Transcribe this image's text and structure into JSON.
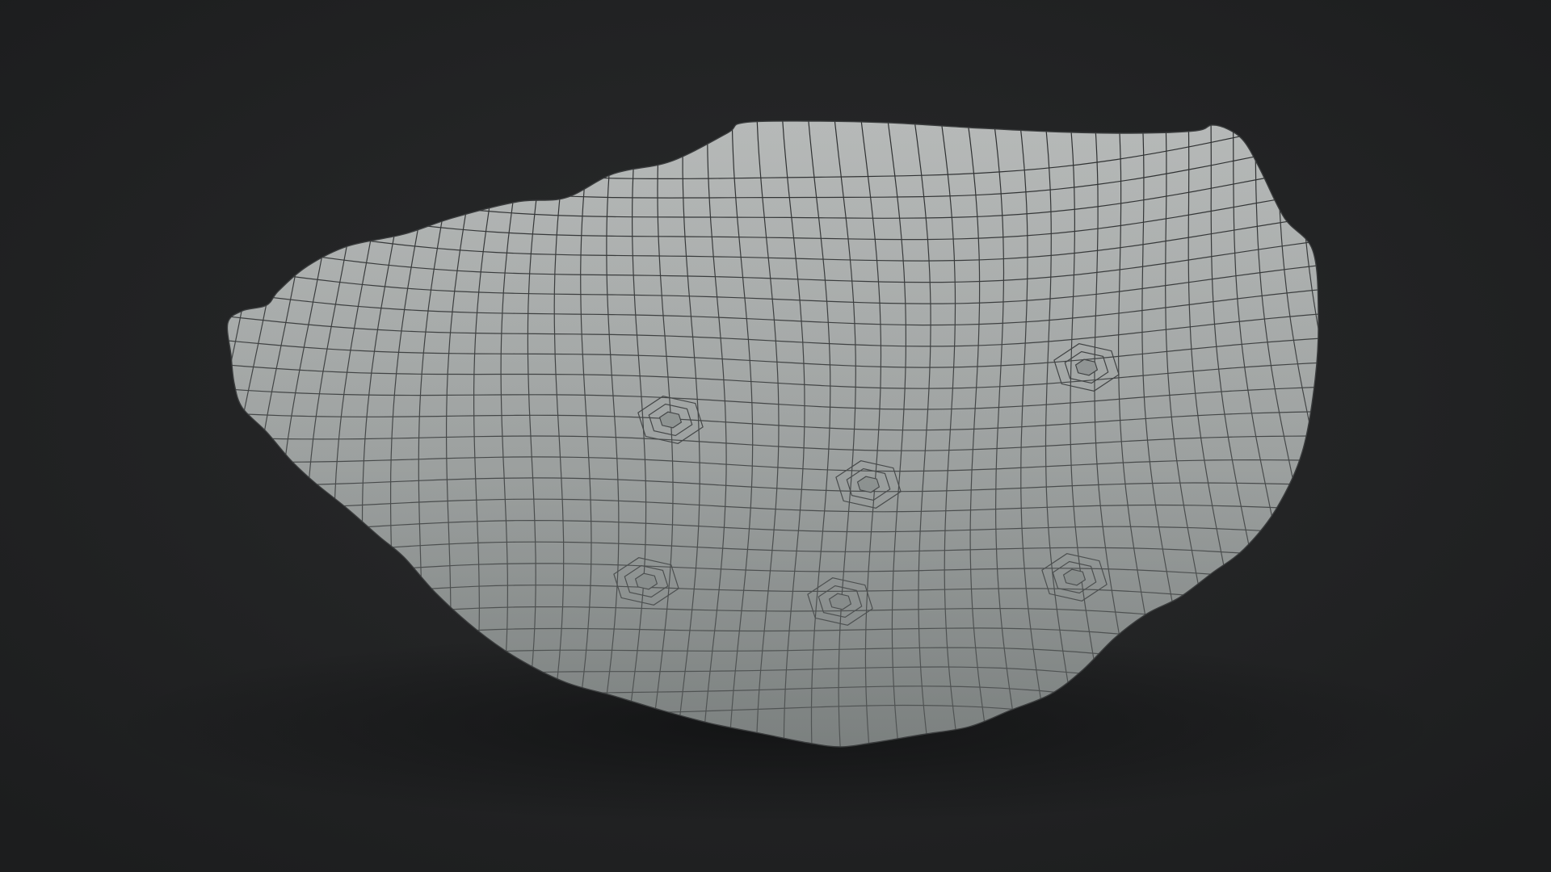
{
  "scene": {
    "subject": "wireframe-rock-mesh",
    "colors": {
      "background": "#1f2021",
      "background_center": "#2a2b2c",
      "surface_light": "#b4b7b6",
      "surface_mid": "#9fa3a2",
      "surface_dark": "#7d8281",
      "wire": "#2b2d2e"
    }
  }
}
